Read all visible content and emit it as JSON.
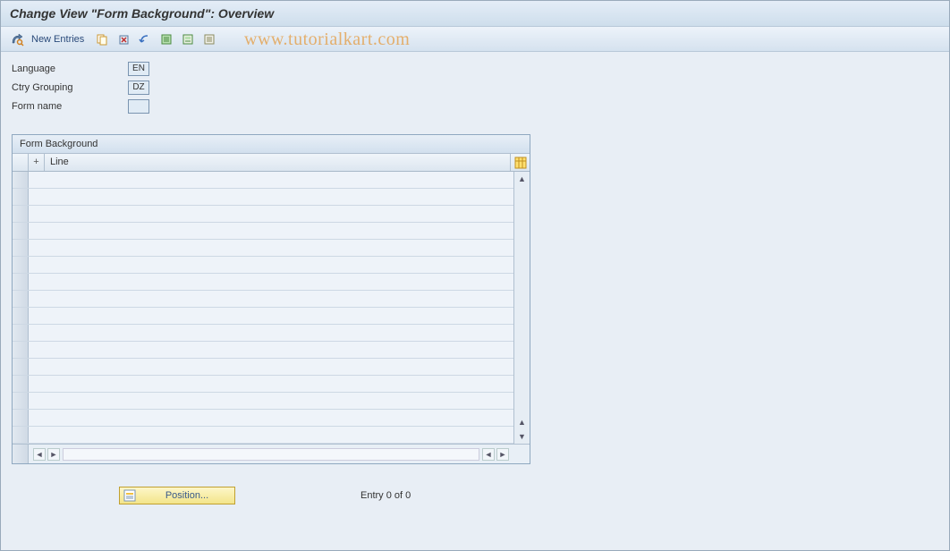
{
  "title": "Change View \"Form Background\": Overview",
  "toolbar": {
    "new_entries_label": "New Entries"
  },
  "watermark": "www.tutorialkart.com",
  "fields": {
    "language_label": "Language",
    "language_value": "EN",
    "ctry_label": "Ctry Grouping",
    "ctry_value": "DZ",
    "formname_label": "Form name",
    "formname_value": ""
  },
  "table": {
    "panel_title": "Form Background",
    "col_plus": "+",
    "col_line": "Line"
  },
  "footer": {
    "position_label": "Position...",
    "entry_status": "Entry 0 of 0"
  }
}
